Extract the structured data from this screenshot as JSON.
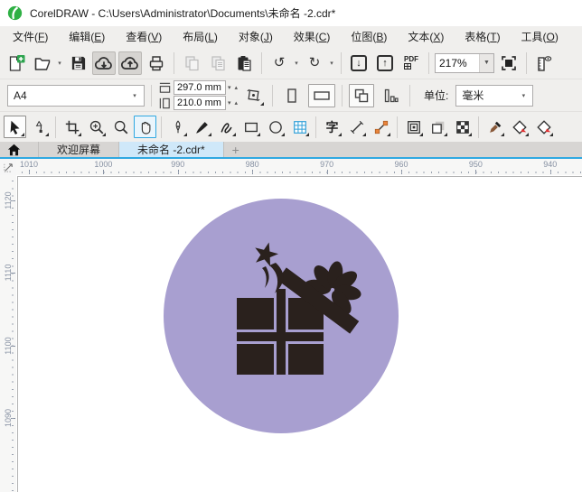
{
  "window": {
    "title": "CorelDRAW - C:\\Users\\Administrator\\Documents\\未命名 -2.cdr*"
  },
  "menu": {
    "items": [
      "文件(F)",
      "编辑(E)",
      "查看(V)",
      "布局(L)",
      "对象(J)",
      "效果(C)",
      "位图(B)",
      "文本(X)",
      "表格(T)",
      "工具(O)"
    ]
  },
  "toolbar": {
    "zoom_level": "217%",
    "pdf_label": "PDF"
  },
  "property_bar": {
    "page_preset": "A4",
    "page_width": "297.0 mm",
    "page_height": "210.0 mm",
    "units_label": "单位:",
    "units_value": "毫米"
  },
  "toolbox": {
    "text_tool_glyph": "字"
  },
  "tabs": {
    "welcome": "欢迎屏幕",
    "document": "未命名 -2.cdr*",
    "new_tab": "+"
  },
  "rulers": {
    "horizontal_labels": [
      "1010",
      "1000",
      "990",
      "980",
      "970",
      "960",
      "950",
      "940"
    ],
    "vertical_labels": [
      "1120",
      "1110",
      "1100",
      "1090"
    ]
  },
  "canvas": {
    "circle_fill": "#a89fd0",
    "glyph_fill": "#2a211d"
  },
  "colors": {
    "accent": "#2fa8e1",
    "tab_active_bg": "#cfe8f9",
    "logo_green": "#2eb044"
  }
}
